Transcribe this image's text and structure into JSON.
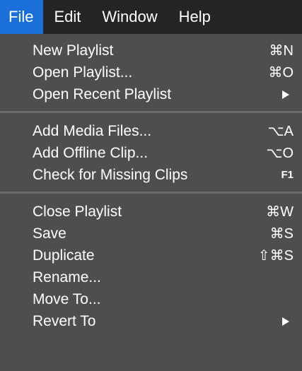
{
  "menubar": {
    "items": [
      {
        "label": "File"
      },
      {
        "label": "Edit"
      },
      {
        "label": "Window"
      },
      {
        "label": "Help"
      }
    ]
  },
  "menu": {
    "group1": [
      {
        "label": "New Playlist",
        "shortcut": "⌘N"
      },
      {
        "label": "Open Playlist...",
        "shortcut": "⌘O"
      },
      {
        "label": "Open Recent Playlist",
        "shortcut": ""
      }
    ],
    "group2": [
      {
        "label": "Add Media Files...",
        "shortcut": "⌥A"
      },
      {
        "label": "Add Offline Clip...",
        "shortcut": "⌥O"
      },
      {
        "label": "Check for Missing Clips",
        "shortcut": "F1"
      }
    ],
    "group3": [
      {
        "label": "Close Playlist",
        "shortcut": "⌘W"
      },
      {
        "label": "Save",
        "shortcut": "⌘S"
      },
      {
        "label": "Duplicate",
        "shortcut": "⇧⌘S"
      },
      {
        "label": "Rename...",
        "shortcut": ""
      },
      {
        "label": "Move To...",
        "shortcut": ""
      },
      {
        "label": "Revert To",
        "shortcut": ""
      }
    ]
  },
  "colors": {
    "accent": "#1a6fd8",
    "menu_background": "#4e4e4e",
    "menubar_background": "#242424",
    "text": "#ffffff"
  }
}
